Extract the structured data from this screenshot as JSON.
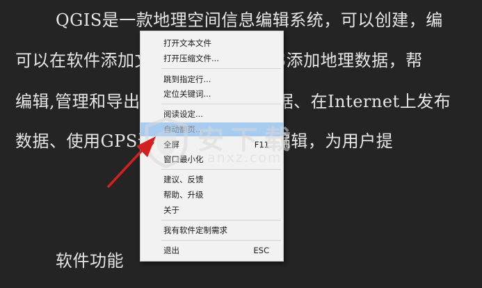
{
  "reader": {
    "lines": [
      "QGIS是一款地理空间信息编辑系统，可以创建，编",
      "可以在软件添加文件，可以使用GIS添加地理数据，帮",
      "编辑,管理和导出数据，可以编辑数据、在Internet上发布",
      "数据、使用GPS进行地理空间信息编辑，为用户提",
      "软件功能"
    ]
  },
  "context_menu": {
    "open_text_file": "打开文本文件",
    "open_archive": "打开压缩文件...",
    "jump_to_line": "跳到指定行...",
    "find_keyword": "定位关键词...",
    "reading_settings": "阅读设定...",
    "auto_page": "自动翻页...",
    "fullscreen": "全屏",
    "fullscreen_shortcut": "F11",
    "fullscreen_check": "✓",
    "minimize": "窗口最小化",
    "feedback": "建议、反馈",
    "help_upgrade": "帮助、升级",
    "about": "关于",
    "custom_request": "我有软件定制需求",
    "exit": "退出",
    "exit_shortcut": "ESC"
  },
  "watermark": {
    "brand": "安下载",
    "domain": "anxz.com"
  },
  "colors": {
    "background": "#242424",
    "text": "#e6e6e6",
    "menu_bg": "#f2f2f2",
    "menu_highlight": "#a8ccef",
    "arrow": "#d42020"
  },
  "icons": {
    "arrow": "red-pointer-arrow",
    "watermark_logo": "shield-logo"
  }
}
